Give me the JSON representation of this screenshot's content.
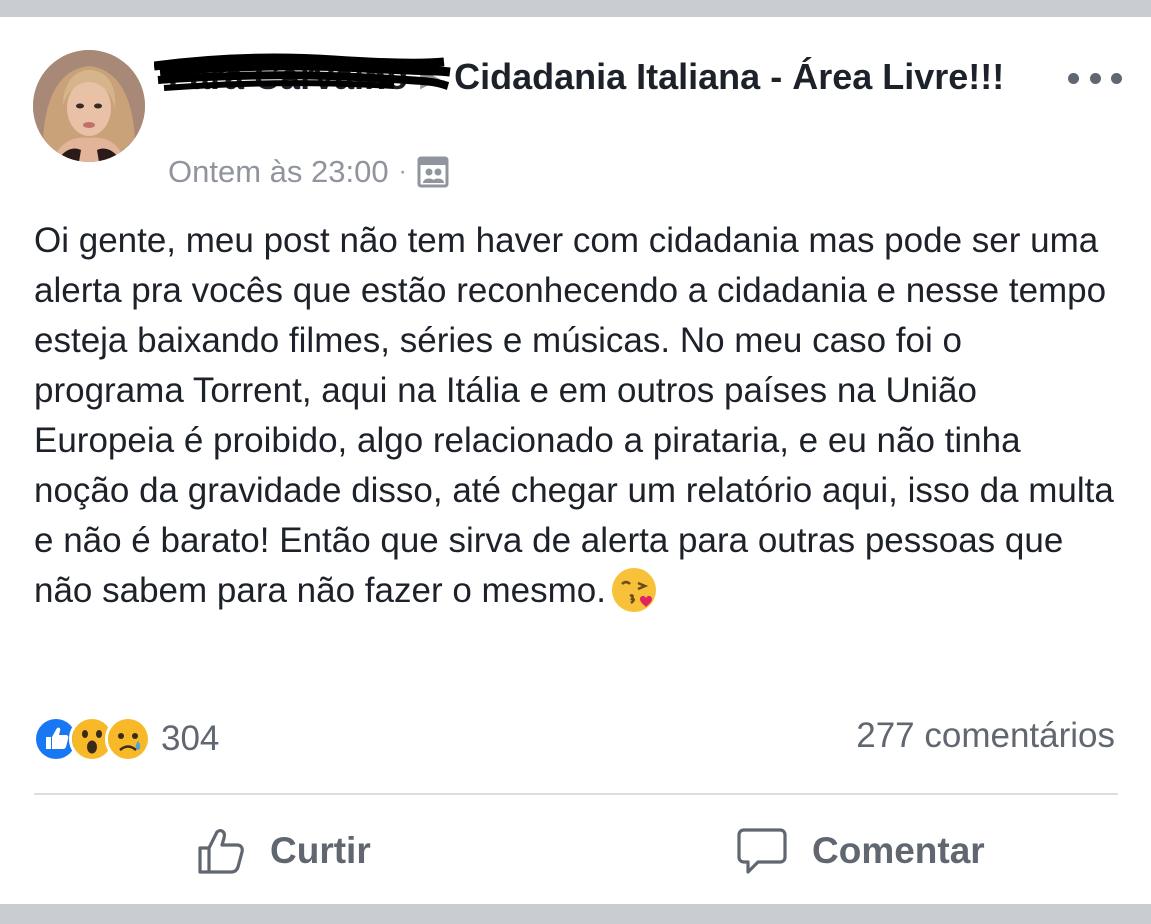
{
  "post": {
    "author_name": "Lara Carvalho",
    "group_name": "Cidadania Italiana - Área Livre!!!",
    "timestamp": "Ontem às 23:00",
    "meta_separator": "·",
    "privacy_icon": "group-members-icon",
    "body": "Oi gente, meu post não tem haver com cidadania mas pode ser uma alerta pra vocês que estão reconhecendo a cidadania e nesse tempo esteja baixando filmes, séries e músicas. No meu caso foi o programa Torrent, aqui na Itália e em outros países na União Europeia é proibido, algo relacionado a pirataria, e eu não tinha noção da gravidade disso, até chegar um relatório aqui, isso da multa e não é barato! Então que sirva de alerta para outras pessoas que não sabem para não fazer o mesmo.",
    "body_emoji": "face-blowing-a-kiss"
  },
  "reactions": {
    "types": [
      "like",
      "wow",
      "sad"
    ],
    "count": "304"
  },
  "comments": {
    "count_label": "277 comentários"
  },
  "actions": {
    "like_label": "Curtir",
    "comment_label": "Comentar"
  },
  "colors": {
    "text_primary": "#1d2129",
    "text_secondary": "#90949c",
    "action_gray": "#606770",
    "like_blue": "#1877f2",
    "reaction_yellow": "#f7b928",
    "frame_gray": "#c9ccd1"
  }
}
